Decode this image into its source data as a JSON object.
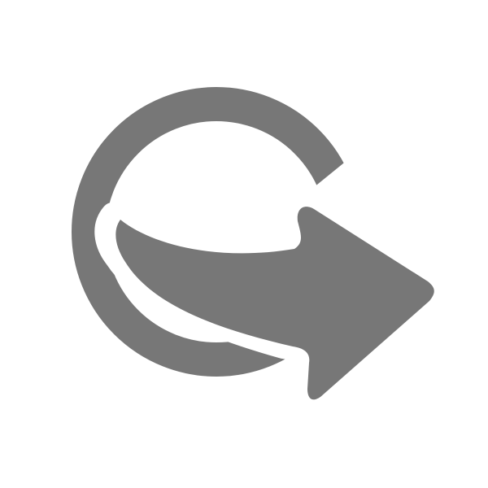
{
  "icon": {
    "name": "export-arrow-icon",
    "color": "#777777"
  },
  "background": "#ffffff"
}
